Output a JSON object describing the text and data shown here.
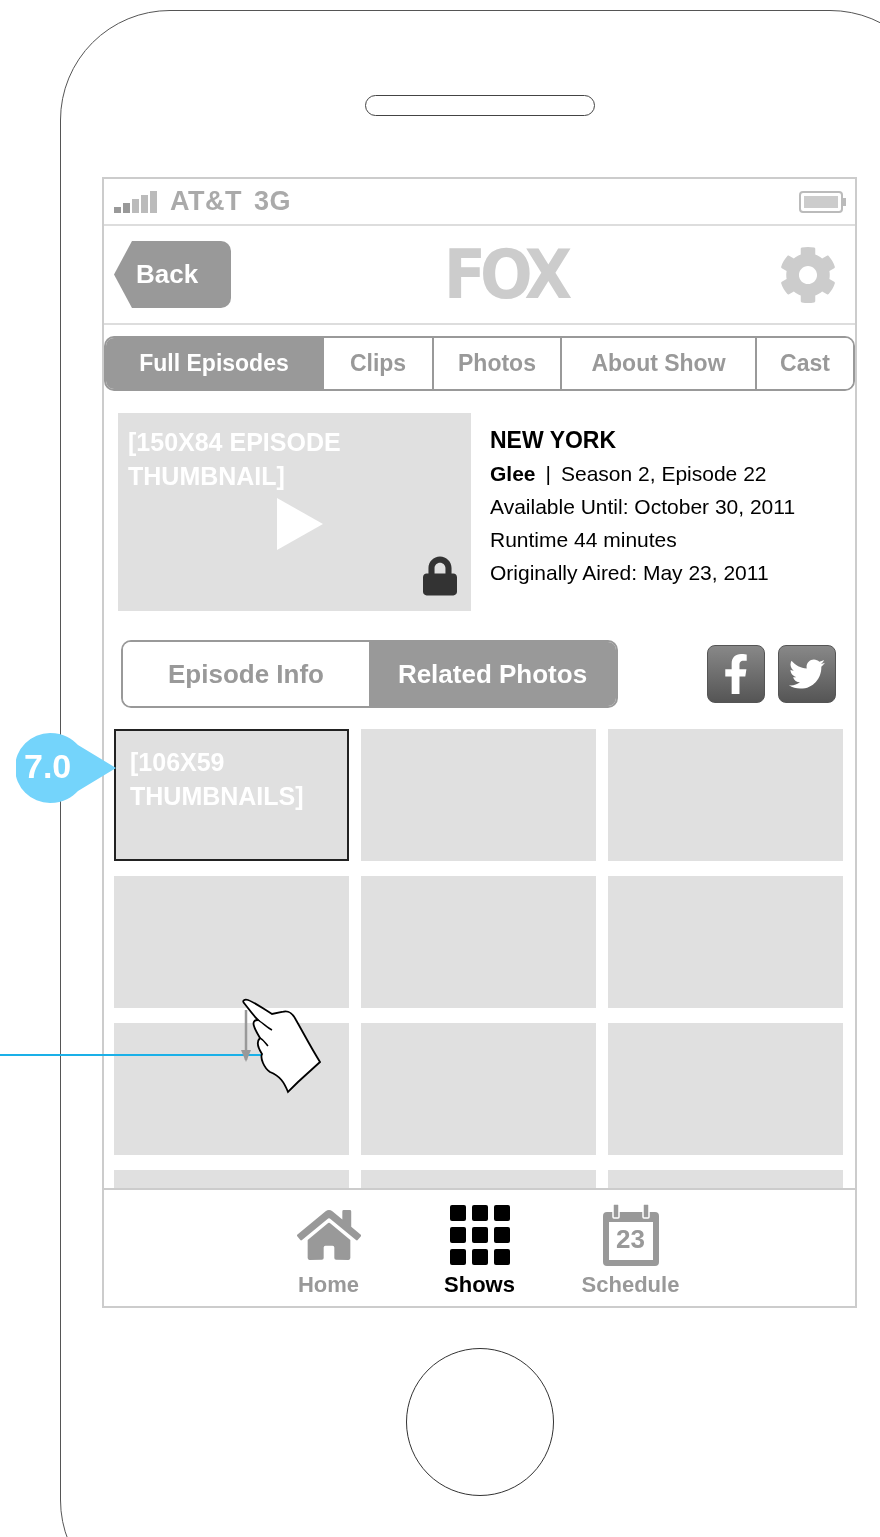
{
  "status_bar": {
    "carrier": "AT&T",
    "network": "3G"
  },
  "nav_bar": {
    "back": "Back",
    "logo": "FOX"
  },
  "tabs": [
    {
      "label": "Full Episodes",
      "selected": true
    },
    {
      "label": "Clips",
      "selected": false
    },
    {
      "label": "Photos",
      "selected": false
    },
    {
      "label": "About Show",
      "selected": false
    },
    {
      "label": "Cast",
      "selected": false
    }
  ],
  "episode": {
    "thumbnail_label": "[150X84 EPISODE THUMBNAIL]",
    "locked": true,
    "title": "NEW YORK",
    "show": "Glee",
    "separator": "|",
    "season_episode": "Season 2, Episode 22",
    "available": "Available Until: October 30, 2011",
    "runtime": "Runtime 44 minutes",
    "aired": "Originally Aired: May 23, 2011"
  },
  "segments": [
    {
      "label": "Episode Info",
      "selected": false
    },
    {
      "label": "Related Photos",
      "selected": true
    }
  ],
  "photos": [
    {
      "label": "[106X59 THUMBNAILS]",
      "selected": true
    },
    {
      "selected": false
    },
    {
      "selected": false
    },
    {
      "selected": false
    },
    {
      "selected": false
    },
    {
      "selected": false
    },
    {
      "selected": false
    },
    {
      "selected": false
    },
    {
      "selected": false
    },
    {
      "selected": false
    },
    {
      "selected": false
    },
    {
      "selected": false
    }
  ],
  "tab_bar": [
    {
      "kind": "home",
      "label": "Home",
      "selected": false
    },
    {
      "kind": "shows",
      "label": "Shows",
      "selected": true
    },
    {
      "kind": "schedule",
      "label": "Schedule",
      "day": "23",
      "selected": false
    }
  ],
  "annotation": {
    "label": "7.0"
  }
}
